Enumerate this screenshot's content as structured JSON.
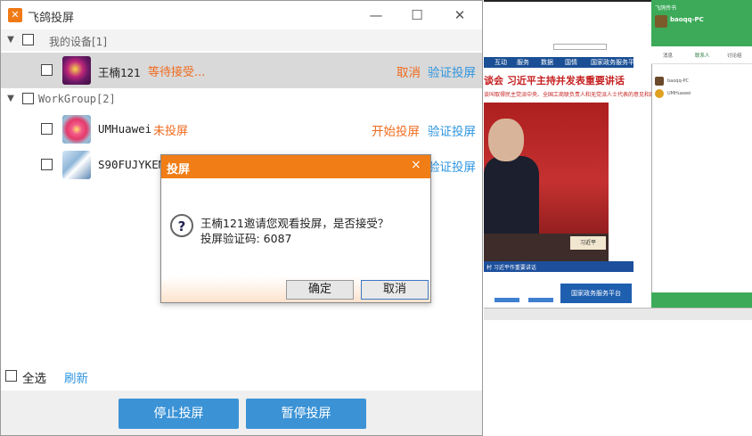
{
  "window": {
    "title": "飞鸽投屏",
    "controls": [
      "minimize",
      "maximize",
      "close"
    ]
  },
  "groups": [
    {
      "label": "我的设备[1]",
      "devices": [
        {
          "name": "王楠121",
          "status": "等待接受...",
          "action_primary": "取消",
          "action_secondary": "验证投屏",
          "highlighted": true
        }
      ]
    },
    {
      "label": "WorkGroup[2]",
      "devices": [
        {
          "name": "UMHuawei",
          "status": "未投屏",
          "action_primary": "开始投屏",
          "action_secondary": "验证投屏",
          "highlighted": false
        },
        {
          "name": "S90FUJYKEM(",
          "status": "",
          "action_primary": "",
          "action_secondary": "验证投屏",
          "highlighted": false
        }
      ]
    }
  ],
  "footer": {
    "select_all_label": "全选",
    "refresh_label": "刷新",
    "stop_button": "停止投屏",
    "pause_button": "暂停投屏"
  },
  "dialog": {
    "title": "投屏",
    "close_glyph": "×",
    "message_line1": "王楠121邀请您观看投屏，是否接受？",
    "message_line2": "投屏验证码: 6087",
    "ok_button": "确定",
    "cancel_button": "取消"
  },
  "preview": {
    "nav_items": [
      "互动",
      "服务",
      "数据",
      "国情",
      "国家政务服务平台"
    ],
    "headline": "谈会 习近平主持并发表重要讲话",
    "subline": "谈叫取得民主党派中央、全国工商联负责人和无党派人士代表的意见和建议",
    "caption": "村 习近平作重要讲话",
    "gov_panel": "国家政务服务平台",
    "sign_text": "习近平",
    "chat": {
      "app_title": "飞鸽传书",
      "user": "baoqq-PC",
      "tabs": [
        "消息",
        "联系人",
        "讨论组"
      ],
      "contacts": [
        "baoqq-PC",
        "UMHuawei"
      ]
    }
  },
  "colors": {
    "accent_orange": "#f06b1e",
    "link_blue": "#2f95e0",
    "button_blue": "#3b93d6",
    "dialog_header": "#f07d16"
  }
}
